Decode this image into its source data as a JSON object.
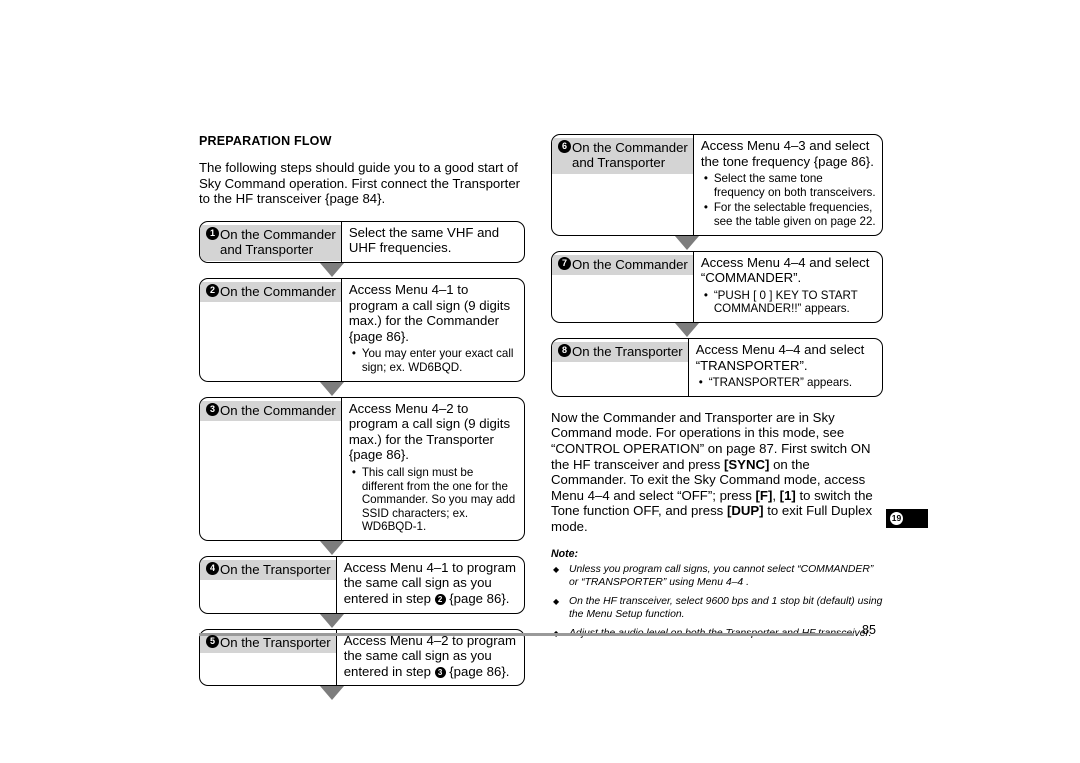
{
  "document": {
    "page_number": "85",
    "tab_number": "19"
  },
  "left_column": {
    "section_title": "PREPARATION FLOW",
    "intro_paragraph": "The following steps should guide you to a good start of Sky Command operation.  First connect the Transporter to the HF transceiver {page 84}.",
    "steps": [
      {
        "number": "1",
        "label": "On the Commander\nand Transporter",
        "main": "Select the same VHF and UHF frequencies.",
        "bullets": []
      },
      {
        "number": "2",
        "label": "On the Commander",
        "main": "Access Menu 4–1 to program a call sign (9 digits max.) for the Commander {page 86}.",
        "bullets": [
          "You may enter your exact call sign; ex. WD6BQD."
        ]
      },
      {
        "number": "3",
        "label": "On the Commander",
        "main": "Access Menu 4–2 to program a call sign (9 digits max.) for the Transporter {page 86}.",
        "bullets": [
          "This call sign must be different from the one for the Commander.  So you may add SSID characters; ex. WD6BQD-1."
        ]
      },
      {
        "number": "4",
        "label": "On the Transporter",
        "main_pre": "Access Menu 4–1 to program the same call sign as you entered in step ",
        "main_badge": "2",
        "main_post": " {page 86}.",
        "bullets": []
      },
      {
        "number": "5",
        "label": "On the Transporter",
        "main_pre": "Access Menu 4–2 to program the same call sign as you entered in step ",
        "main_badge": "3",
        "main_post": " {page 86}.",
        "bullets": []
      }
    ]
  },
  "right_column": {
    "steps": [
      {
        "number": "6",
        "label": "On the Commander\nand Transporter",
        "main": "Access Menu 4–3 and select the tone frequency {page 86}.",
        "bullets": [
          "Select the same tone frequency on both transceivers.",
          "For the selectable frequencies, see the table given on page 22."
        ]
      },
      {
        "number": "7",
        "label": "On the Commander",
        "main": "Access Menu 4–4 and select “COMMANDER”.",
        "bullets": [
          "“PUSH [ 0 ] KEY TO START COMMANDER!!” appears."
        ]
      },
      {
        "number": "8",
        "label": "On the Transporter",
        "main": "Access Menu 4–4 and select “TRANSPORTER”.",
        "bullets": [
          "“TRANSPORTER” appears."
        ]
      }
    ],
    "closing_paragraph": {
      "p1": "Now the Commander and Transporter are in Sky Command mode.  For operations in this mode, see “CONTROL OPERATION” on page 87.  First switch ON the HF transceiver and press ",
      "key1": "[SYNC]",
      "p2": " on the Commander.  To exit the Sky Command mode, access Menu 4–4 and select “OFF”; press ",
      "key2": "[F]",
      "p3": ", ",
      "key3": "[1]",
      "p4": " to switch the Tone function OFF, and press ",
      "key4": "[DUP]",
      "p5": " to exit Full Duplex mode."
    },
    "note": {
      "title": "Note:",
      "items": [
        "Unless you program call signs, you cannot select “COMMANDER” or “TRANSPORTER” using Menu 4–4 .",
        "On the HF transceiver, select 9600 bps and 1 stop bit (default) using the Menu Setup function.",
        "Adjust the audio level on both the Transporter and HF transceiver."
      ]
    }
  }
}
